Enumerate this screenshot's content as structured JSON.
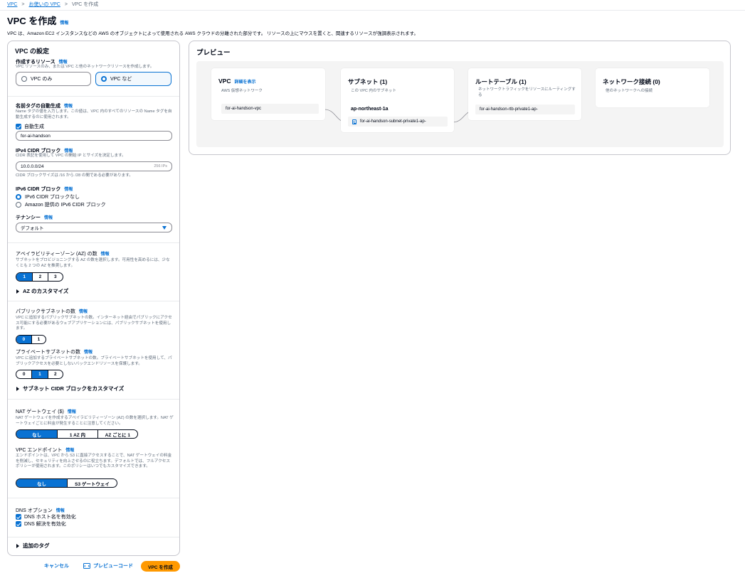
{
  "breadcrumb": {
    "items": [
      "VPC",
      "お使いの VPC"
    ],
    "current": "VPC を作成"
  },
  "page": {
    "title": "VPC を作成",
    "info": "情報",
    "description": "VPC は、Amazon EC2 インスタンスなどの AWS のオブジェクトによって使用される AWS クラウドの分離された部分です。 リソースの上にマウスを置くと、関連するリソースが強調表示されます。"
  },
  "settings": {
    "title": "VPC の設定",
    "info": "情報",
    "resources": {
      "label": "作成するリソース",
      "description": "VPC リソースのみ、または VPC と他のネットワークリソースを作成します。",
      "options": [
        "VPC のみ",
        "VPC など"
      ],
      "selected": "VPC など"
    },
    "name_tag": {
      "label": "名前タグの自動生成",
      "description": "Name タグの値を入力します。この値は、VPC 内のすべてのリソースの Name タグを自動生成するのに使用されます。",
      "auto_label": "自動生成",
      "value": "for-ai-handson"
    },
    "ipv4": {
      "label": "IPv4 CIDR ブロック",
      "description": "CIDR 表記を使用して VPC の開始 IP とサイズを決定します。",
      "value": "10.0.0.0/24",
      "suffix": "256 IPs",
      "constraint": "CIDR ブロックサイズは /16 から /28 の間である必要があります。"
    },
    "ipv6": {
      "label": "IPv6 CIDR ブロック",
      "options": [
        "IPv6 CIDR ブロックなし",
        "Amazon 提供の IPv6 CIDR ブロック"
      ]
    },
    "tenancy": {
      "label": "テナンシー",
      "value": "デフォルト"
    },
    "az": {
      "label": "アベイラビリティーゾーン (AZ) の数",
      "description": "サブネットをプロビジョニングする AZ の数を選択します。可用性を高めるには、少なくとも 2 つの AZ を推奨します。",
      "options": [
        "1",
        "2",
        "3"
      ],
      "selected": "1",
      "customize": "AZ のカスタマイズ"
    },
    "public_subnets": {
      "label": "パブリックサブネットの数",
      "description": "VPC に追加するパブリックサブネットの数。インターネット経由でパブリックにアクセス可能にする必要があるウェブアプリケーションには、パブリックサブネットを使用します。",
      "options": [
        "0",
        "1"
      ],
      "selected": "0"
    },
    "private_subnets": {
      "label": "プライベートサブネットの数",
      "description": "VPC に追加するプライベートサブネットの数。プライベートサブネットを使用して、パブリックアクセスを必要としないバックエンドリソースを保護します。",
      "options": [
        "0",
        "1",
        "2"
      ],
      "selected": "1",
      "customize": "サブネット CIDR ブロックをカスタマイズ"
    },
    "nat": {
      "label": "NAT ゲートウェイ ($)",
      "description": "NAT ゲートウェイを作成するアベイラビリティーゾーン (AZ) の数を選択します。NAT ゲートウェイごとに料金が発生することに注意してください。",
      "options": [
        "なし",
        "1 AZ 内",
        "AZ ごとに 1"
      ],
      "selected": "なし"
    },
    "endpoint": {
      "label": "VPC エンドポイント",
      "description": "エンドポイントは、VPC から S3 に直接アクセスすることで、NAT ゲートウェイの料金を削減し、セキュリティを向上させるのに役立ちます。デフォルトでは、フルアクセスポリシーが使用されます。このポリシーはいつでもカスタマイズできます。",
      "options": [
        "なし",
        "S3 ゲートウェイ"
      ],
      "selected": "なし"
    },
    "dns": {
      "label": "DNS オプション",
      "options": [
        "DNS ホスト名を有効化",
        "DNS 解決を有効化"
      ]
    },
    "tags": {
      "label": "追加のタグ"
    }
  },
  "actions": {
    "cancel": "キャンセル",
    "preview_code": "プレビューコード",
    "create": "VPC を作成"
  },
  "preview": {
    "title": "プレビュー",
    "vpc": {
      "title": "VPC",
      "link": "詳細を表示",
      "subtitle": "AWS 仮想ネットワーク",
      "resource": "for-ai-handson-vpc"
    },
    "subnets": {
      "title": "サブネット (1)",
      "subtitle": "この VPC 内のサブネット",
      "az": "ap-northeast-1a",
      "resource": "for-ai-handson-subnet-private1-ap-"
    },
    "route_tables": {
      "title": "ルートテーブル (1)",
      "subtitle": "ネットワークトラフィックをリソースにルーティングする",
      "resource": "for-ai-handson-rtb-private1-ap-"
    },
    "network": {
      "title": "ネットワーク接続 (0)",
      "subtitle": "他のネットワークへの接続"
    }
  },
  "colors": {
    "accent": "#0972d3",
    "primary_button": "#ff9900",
    "text": "#000716",
    "muted": "#5f6b7a"
  }
}
